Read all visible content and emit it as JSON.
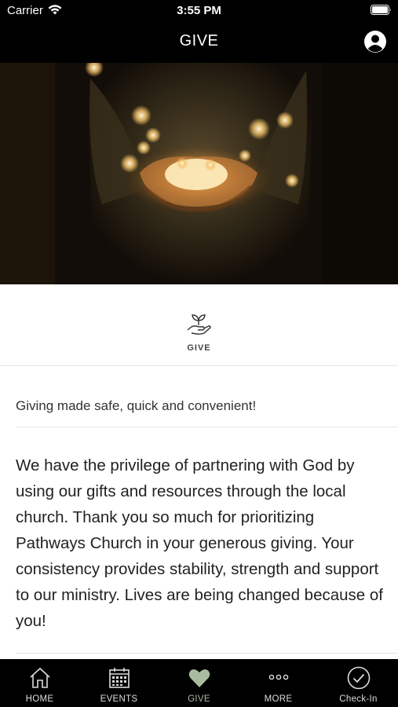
{
  "status_bar": {
    "carrier": "Carrier",
    "time": "3:55 PM"
  },
  "header": {
    "title": "GIVE"
  },
  "section": {
    "label": "GIVE"
  },
  "content": {
    "subtitle": "Giving made safe, quick and convenient!",
    "body": "We have the privilege of partnering with God by using our gifts and resources through the local church. Thank you so much for prioritizing Pathways Church in your generous giving. Your consistency provides stability, strength and support to our ministry. Lives are being changed because of you!"
  },
  "tabs": [
    {
      "label": "HOME",
      "icon": "home-icon"
    },
    {
      "label": "EVENTS",
      "icon": "calendar-icon"
    },
    {
      "label": "GIVE",
      "icon": "heart-icon",
      "active": true
    },
    {
      "label": "MORE",
      "icon": "more-dots-icon"
    },
    {
      "label": "Check-In",
      "icon": "checkmark-circle-icon"
    }
  ],
  "colors": {
    "active_tab": "#a8bda0",
    "bar_background": "#000000"
  }
}
